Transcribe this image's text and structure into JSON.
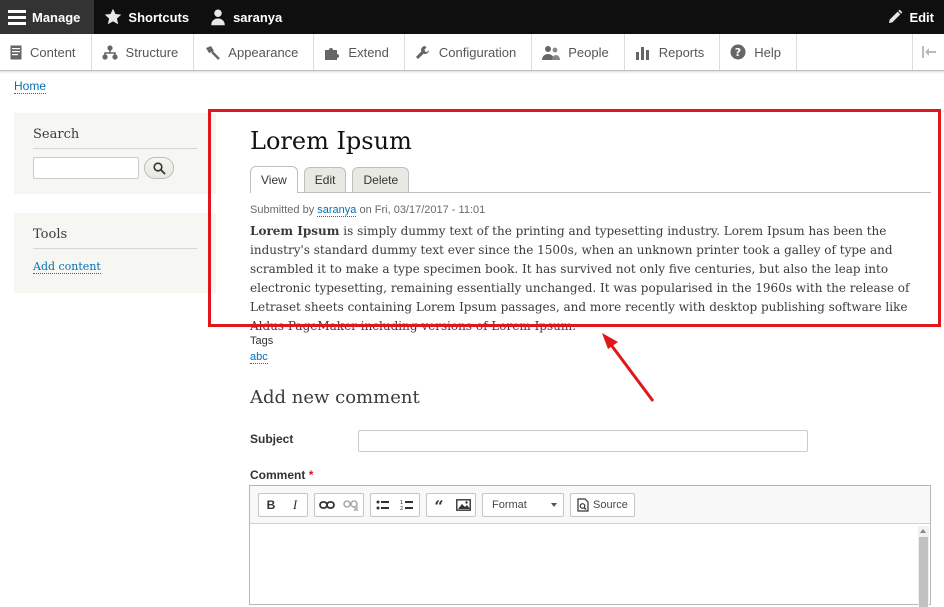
{
  "toolbar": {
    "manage_label": "Manage",
    "shortcuts_label": "Shortcuts",
    "user_label": "saranya",
    "edit_label": "Edit"
  },
  "tray": {
    "items": [
      {
        "label": "Content",
        "icon": "page-icon"
      },
      {
        "label": "Structure",
        "icon": "hierarchy-icon"
      },
      {
        "label": "Appearance",
        "icon": "paintbrush-icon"
      },
      {
        "label": "Extend",
        "icon": "puzzle-icon"
      },
      {
        "label": "Configuration",
        "icon": "wrench-icon"
      },
      {
        "label": "People",
        "icon": "people-icon"
      },
      {
        "label": "Reports",
        "icon": "bar-chart-icon"
      },
      {
        "label": "Help",
        "icon": "help-icon"
      }
    ]
  },
  "breadcrumb": {
    "home": "Home"
  },
  "sidebar": {
    "search_title": "Search",
    "tools_title": "Tools",
    "add_content": "Add content"
  },
  "node": {
    "title": "Lorem Ipsum",
    "tabs": [
      "View",
      "Edit",
      "Delete"
    ],
    "submitted_prefix": "Submitted by",
    "author": "saranya",
    "submitted_suffix": "on Fri, 03/17/2017 - 11:01",
    "body_bold": "Lorem Ipsum",
    "body_rest": " is simply dummy text of the printing and typesetting industry. Lorem Ipsum has been the industry's standard dummy text ever since the 1500s, when an unknown printer took a galley of type and scrambled it to make a type specimen book. It has survived not only five centuries, but also the leap into electronic typesetting, remaining essentially unchanged. It was popularised in the 1960s with the release of Letraset sheets containing Lorem Ipsum passages, and more recently with desktop publishing software like Aldus PageMaker including versions of Lorem Ipsum.",
    "tags_label": "Tags",
    "tag": "abc"
  },
  "comment_form": {
    "title": "Add new comment",
    "subject_label": "Subject",
    "subject_value": "",
    "comment_label": "Comment",
    "required_mark": "*",
    "format_label": "Format",
    "source_label": "Source"
  },
  "colors": {
    "highlight": "#e0161a",
    "link": "#0071b3",
    "toolbar_bg": "#0f0f0f"
  }
}
